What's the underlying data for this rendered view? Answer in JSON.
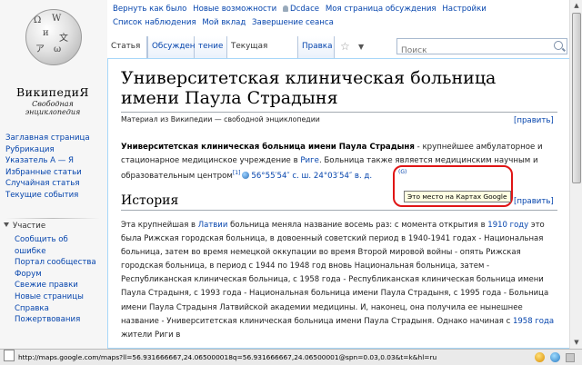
{
  "personal_tools": {
    "row1": [
      "Вернуть как было",
      "Новые возможности",
      "Dcdace",
      "Моя страница обсуждения",
      "Настройки"
    ],
    "row2": [
      "Список наблюдения",
      "Мой вклад",
      "Завершение сеанса"
    ]
  },
  "logo": {
    "wordmark": "ВикипедиЯ",
    "tagline": "Свободная энциклопедия"
  },
  "nav_main": [
    "Заглавная страница",
    "Рубрикация",
    "Указатель А — Я",
    "Избранные статьи",
    "Случайная статья",
    "Текущие события"
  ],
  "portal": {
    "heading": "Участие",
    "items": [
      "Сообщить об",
      "ошибке",
      "Портал сообщества",
      "Форум",
      "Свежие правки",
      "Новые страницы",
      "Справка",
      "Пожертвования"
    ]
  },
  "tabs": {
    "article": "Статья",
    "discussion": "Обсуждение",
    "reading": "тение",
    "current": "Текущая версия",
    "edit": "Правка",
    "star": "☆",
    "dropdown": "▼"
  },
  "search": {
    "placeholder": "Поиск"
  },
  "article": {
    "title": "Университетская клиническая больница имени Паула Страдыня",
    "from": "Материал из Википедии — свободной энциклопедии",
    "edit_label": "[править]",
    "intro": {
      "bold": "Университетская клиническая больница имени Паула Страдыня",
      "text1": " - крупнейшее амбулаторное и стационарное медицинское учреждение в ",
      "link_riga": "Риге",
      "text2": ". Больница также является медицинским научным и образовательным центром",
      "ref": "[1]",
      "coords": "56°55′54″ с. ш. 24°03′54″ в. д."
    },
    "section_history": "История",
    "history": {
      "t1": "Эта крупнейшая в ",
      "latvia": "Латвии",
      "t2": " больница меняла название восемь раз: с момента открытия в ",
      "y1910": "1910 году",
      "t3": " это была Рижская городская больница, в довоенный советский период в 1940-1941 годах - Национальная больница, затем во время немецкой оккупации во время Второй мировой войны - опять Рижская городская больница, в период с 1944 по 1948 год вновь Национальная больница, затем - Республиканская клиническая больница, с 1958 года - Республиканская клиническая больница имени Паула Страдыня, с 1993 года - Национальная больница имени Паула Страдыня, с 1995 года - Больница имени Паула Страдыня Латвийской академии медицины. И, наконец, она получила ее нынешнее название - Университетская клиническая больница имени Паула Страдыня. Однако начиная с ",
      "y1958": "1958 года",
      "t4": " жители Риги в"
    }
  },
  "tooltip": {
    "small_link": "(G)",
    "text": "Это место на Картах Google"
  },
  "status_bar": {
    "url": "http://maps.google.com/maps?ll=56.931666667,24.065000018q=56.931666667,24.06500001@spn=0.03,0.03&t=k&hl=ru"
  }
}
